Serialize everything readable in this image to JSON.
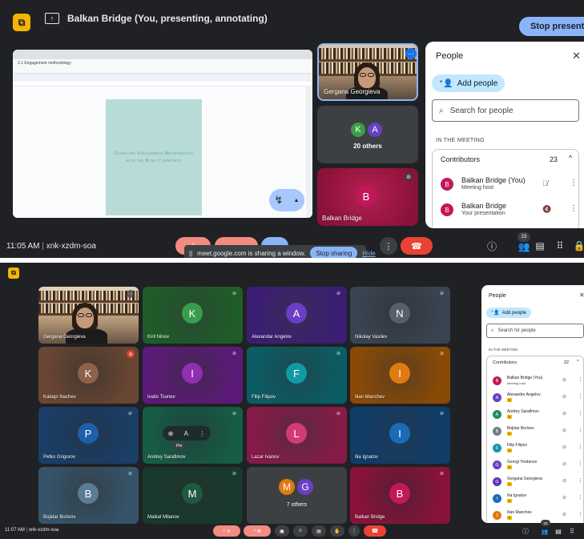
{
  "colors": {
    "meet_bg": "#202124",
    "accent_blue": "#8ab4f8",
    "end_call_red": "#ea4335",
    "brand_yellow": "#f6b400",
    "panel_white": "#ffffff"
  },
  "shot1": {
    "presenting_label": "Balkan Bridge (You, presenting, annotating)",
    "stop_presenting_label": "Stop presenting",
    "document_title": "Guideline: Engagement Methodology with the Roma Community",
    "document_file_name": "2.1 Engagement methodology",
    "tiles": {
      "presenter_name": "Gergana Georgieva",
      "others_initials": [
        "K",
        "A"
      ],
      "others_label": "20 others",
      "self_initial": "B",
      "self_name": "Balkan Bridge"
    },
    "meeting_time": "11:05 AM",
    "meeting_code": "xnk-xzdm-soa",
    "share_banner": {
      "text": "meet.google.com is sharing a window.",
      "stop_sharing_label": "Stop sharing",
      "hide_label": "Hide"
    },
    "people_count": "23",
    "people_panel": {
      "title": "People",
      "add_people_label": "Add people",
      "search_placeholder": "Search for people",
      "section_label": "IN THE MEETING",
      "group_label": "Contributors",
      "group_count": "23",
      "rows": [
        {
          "initial": "B",
          "name": "Balkan Bridge (You)",
          "sub": "Meeting host",
          "color": "#c2185b"
        },
        {
          "initial": "B",
          "name": "Balkan Bridge",
          "sub": "Your presentation",
          "color": "#c2185b"
        }
      ]
    }
  },
  "shot2": {
    "tiles": [
      {
        "name": "Gergana Georgieva",
        "initial": "",
        "color": "#d6c3a8",
        "avatar_color": "",
        "video": true
      },
      {
        "name": "Kiril Ninov",
        "initial": "K",
        "color": "#1e5c2a",
        "avatar_color": "#3a9d4a"
      },
      {
        "name": "Alexandar Angelov",
        "initial": "A",
        "color": "#3c1d74",
        "avatar_color": "#6a3fc4"
      },
      {
        "name": "Nikolay Vasilev",
        "initial": "N",
        "color": "#3a4450",
        "avatar_color": "#56606c"
      },
      {
        "name": "Kaloqn Nachev",
        "initial": "K",
        "color": "#6a4632",
        "avatar_color": "#8d6248"
      },
      {
        "name": "Ivailo Tsonev",
        "initial": "I",
        "color": "#5c1a78",
        "avatar_color": "#8e2fb4"
      },
      {
        "name": "Filip Filipov",
        "initial": "F",
        "color": "#0b5c64",
        "avatar_color": "#129aa4"
      },
      {
        "name": "Ilian Manchev",
        "initial": "I",
        "color": "#8a4a06",
        "avatar_color": "#e07a10"
      },
      {
        "name": "Petko Grigorov",
        "initial": "P",
        "color": "#1a3e66",
        "avatar_color": "#1f5fa8"
      },
      {
        "name": "Andrey Sarafimov",
        "initial": "",
        "color": "#165c46",
        "avatar_color": "#1f8a68"
      },
      {
        "name": "Lazar Ivanov",
        "initial": "L",
        "color": "#861a48",
        "avatar_color": "#d43a7a"
      },
      {
        "name": "Ilia Ignatov",
        "initial": "I",
        "color": "#0f3d68",
        "avatar_color": "#1c6bb8"
      },
      {
        "name": "Bojidar Borisov",
        "initial": "B",
        "color": "#35546a",
        "avatar_color": "#5b7d94"
      },
      {
        "name": "Maikal Milanov",
        "initial": "M",
        "color": "#173a2c",
        "avatar_color": "#1e5a40"
      },
      {
        "name": "",
        "initial": "",
        "color": "#3c4043",
        "avatar_color": "",
        "others": true,
        "others_initials": [
          "M",
          "G"
        ],
        "others_label": "7 others"
      },
      {
        "name": "Balkan Bridge",
        "initial": "B",
        "color": "#8a1238",
        "avatar_color": "#c2185b"
      }
    ],
    "pin_tooltip": "Pin",
    "meeting_time": "11:07 AM",
    "meeting_code": "xnk-xzdm-soa",
    "people_count": "22",
    "people_panel": {
      "title": "People",
      "add_people_label": "Add people",
      "search_placeholder": "Search for people",
      "section_label": "IN THE MEETING",
      "group_label": "Contributors",
      "group_count": "22",
      "rows": [
        {
          "initial": "B",
          "name": "Balkan Bridge (You)",
          "sub": "Meeting host",
          "color": "#c2185b",
          "badge": false
        },
        {
          "initial": "A",
          "name": "Alexander Angelov",
          "sub": "",
          "color": "#6a3fc4",
          "badge": true
        },
        {
          "initial": "A",
          "name": "Andrey Sarafimov",
          "sub": "",
          "color": "#1f8a68",
          "badge": true
        },
        {
          "initial": "B",
          "name": "Bojidar Borisov",
          "sub": "",
          "color": "#6f7c88",
          "badge": true
        },
        {
          "initial": "F",
          "name": "Filip Filipov",
          "sub": "",
          "color": "#129aa4",
          "badge": true
        },
        {
          "initial": "G",
          "name": "Georgi Yordanov",
          "sub": "",
          "color": "#6a3fc4",
          "badge": true
        },
        {
          "initial": "G",
          "name": "Gergana Georgieva",
          "sub": "",
          "color": "#5b35b8",
          "badge": true
        },
        {
          "initial": "I",
          "name": "Ilia Ignatov",
          "sub": "",
          "color": "#1c6bb8",
          "badge": true
        },
        {
          "initial": "I",
          "name": "Ilian Manchev",
          "sub": "",
          "color": "#e07a10",
          "badge": true
        }
      ]
    }
  }
}
